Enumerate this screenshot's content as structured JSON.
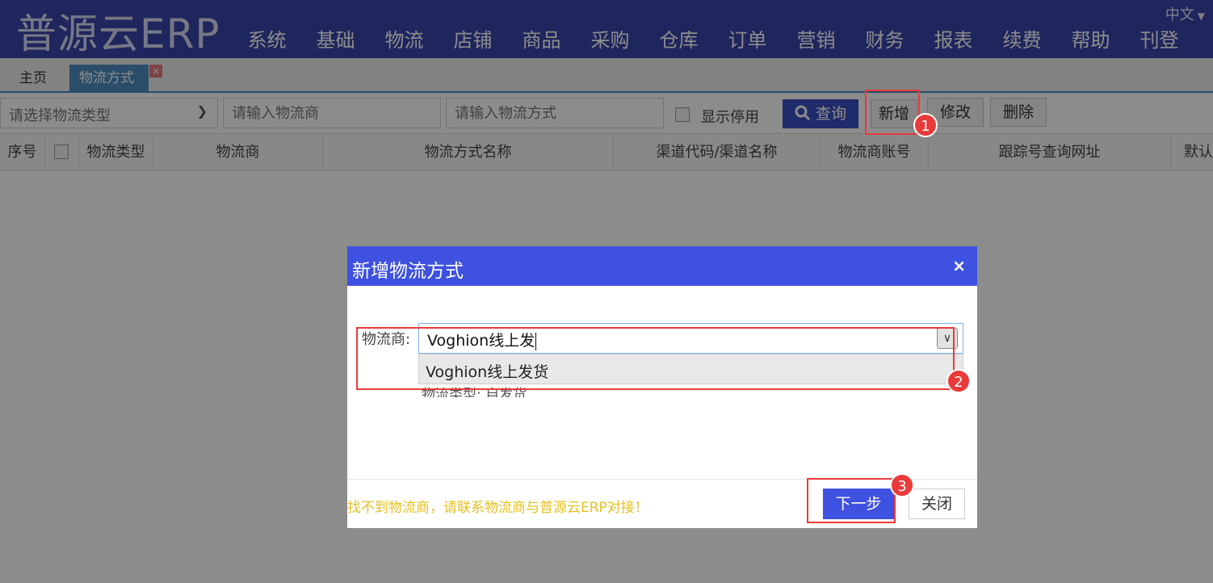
{
  "header": {
    "brand": "普源云ERP",
    "nav": [
      "系统",
      "基础",
      "物流",
      "店铺",
      "商品",
      "采购",
      "仓库",
      "订单",
      "营销",
      "财务",
      "报表",
      "续费",
      "帮助",
      "刊登"
    ],
    "language": "中文"
  },
  "tabs": {
    "home": "主页",
    "active": "物流方式",
    "close": "×"
  },
  "toolbar": {
    "type_select_placeholder": "请选择物流类型",
    "carrier_placeholder": "请输入物流商",
    "method_placeholder": "请输入物流方式",
    "show_disabled": "显示停用",
    "query": "查询",
    "add": "新增",
    "edit": "修改",
    "delete": "删除"
  },
  "table": {
    "columns": [
      "序号",
      "物流类型",
      "物流商",
      "物流方式名称",
      "渠道代码/渠道名称",
      "物流商账号",
      "跟踪号查询网址",
      "默认"
    ]
  },
  "dialog": {
    "title": "新增物流方式",
    "close": "×",
    "carrier_label": "物流商:",
    "carrier_value": "Voghion线上发",
    "dropdown_option": "Voghion线上发货",
    "type_line": "物流类型: 自发货",
    "footer_note": "找不到物流商，请联系物流商与普源云ERP对接！",
    "next": "下一步",
    "close_btn": "关闭"
  },
  "annotations": [
    "1",
    "2",
    "3"
  ],
  "colors": {
    "header_bg": "#3a45ab",
    "dialog_header": "#3f51e0",
    "annotation": "#ea3a3a",
    "note": "#e7c020"
  }
}
